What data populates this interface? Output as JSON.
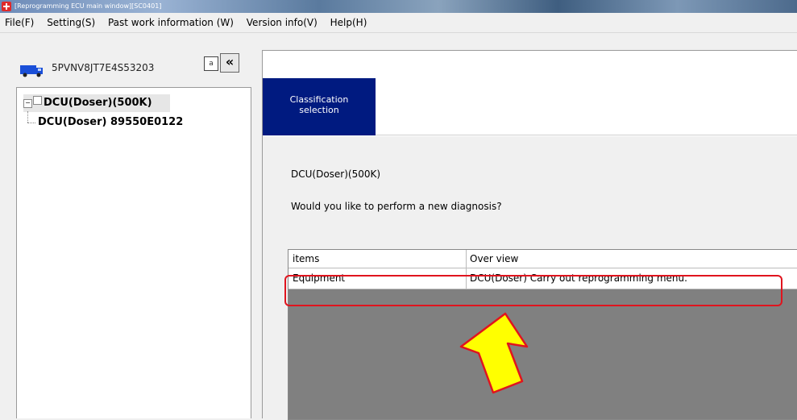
{
  "window": {
    "title": "[Reprogramming ECU main window][SC0401]",
    "icon": "app-icon"
  },
  "menu": {
    "items": [
      {
        "label": "File(F)"
      },
      {
        "label": "Setting(S)"
      },
      {
        "label": "Past work information (W)"
      },
      {
        "label": "Version info(V)"
      },
      {
        "label": "Help(H)"
      }
    ]
  },
  "sidebar": {
    "vin": "5PVNV8JT7E4S53203",
    "vehicle_icon": "truck-icon",
    "text_toggle_label": "a",
    "collapse_label": "«",
    "tree": {
      "root": {
        "expander": "−",
        "label": "DCU(Doser)(500K)"
      },
      "child": {
        "label": "DCU(Doser) 89550E0122"
      }
    }
  },
  "main": {
    "tab": {
      "line1": "Classification",
      "line2": "selection"
    },
    "title": "DCU(Doser)(500K)",
    "question": "Would you like to perform a new diagnosis?",
    "table": {
      "headers": [
        "items",
        "Over view"
      ],
      "rows": [
        {
          "item": "Equipment",
          "overview": "DCU(Doser) Carry out reprogramming menu."
        }
      ]
    }
  },
  "annotation": {
    "highlight_color": "#e0141e",
    "arrow_fill": "#ffff00",
    "arrow_stroke": "#e0141e"
  }
}
